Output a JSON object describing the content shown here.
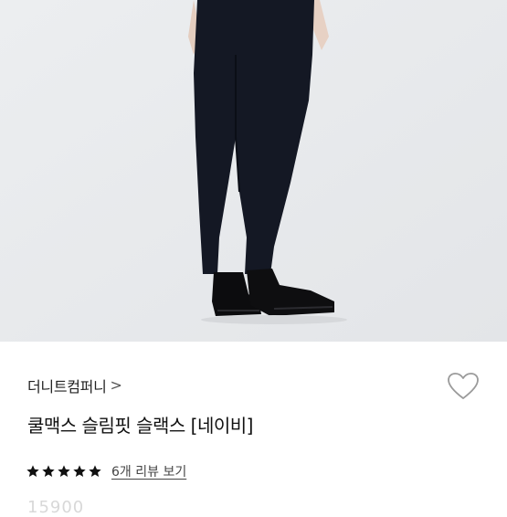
{
  "product": {
    "brand": "더니트컴퍼니",
    "brand_chevron": ">",
    "title": "쿨맥스 슬림핏 슬랙스 [네이비]",
    "rating": 5,
    "rating_max": 5,
    "review_link": "6개 리뷰 보기",
    "price_partial": "15900"
  },
  "icons": {
    "wishlist": "heart-outline-icon",
    "star": "star-filled-icon"
  },
  "colors": {
    "star": "#111111",
    "pants": "#141824",
    "hero_bg": "#e9eaec"
  }
}
